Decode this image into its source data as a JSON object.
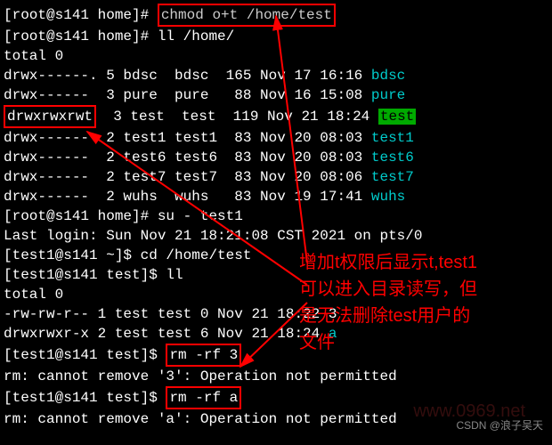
{
  "lines": {
    "l1_prompt": "[root@s141 home]# ",
    "l1_cmd": "chmod o+t /home/test",
    "l2": "[root@s141 home]# ll /home/",
    "l3": "total 0",
    "l4a": "drwx------. 5 bdsc  bdsc  165 Nov 17 16:16 ",
    "l4b": "bdsc",
    "l5a": "drwx------  3 pure  pure   88 Nov 16 15:08 ",
    "l5b": "pure",
    "l6perm": "drwxrwxrwt",
    "l6mid": "  3 test  test  119 Nov 21 18:24 ",
    "l6name": "test",
    "l7a": "drwx------  2 test1 test1  83 Nov 20 08:03 ",
    "l7b": "test1",
    "l8a": "drwx------  2 test6 test6  83 Nov 20 08:03 ",
    "l8b": "test6",
    "l9a": "drwx------  2 test7 test7  83 Nov 20 08:06 ",
    "l9b": "test7",
    "l10a": "drwx------  2 wuhs  wuhs   83 Nov 19 17:41 ",
    "l10b": "wuhs",
    "l11": "[root@s141 home]# su - test1",
    "l12": "Last login: Sun Nov 21 18:21:08 CST 2021 on pts/0",
    "l13": "[test1@s141 ~]$ cd /home/test",
    "l14": "[test1@s141 test]$ ll",
    "l15": "total 0",
    "l16": "-rw-rw-r-- 1 test test 0 Nov 21 18:22 3",
    "l17a": "drwxrwxr-x 2 test test 6 Nov 21 18:24 ",
    "l17b": "a",
    "l18_prompt": "[test1@s141 test]$ ",
    "l18_cmd": "rm -rf 3",
    "l19": "rm: cannot remove '3': Operation not permitted",
    "l20_prompt": "[test1@s141 test]$ ",
    "l20_cmd": "rm -rf a",
    "l21": "rm: cannot remove 'a': Operation not permitted"
  },
  "annotation": {
    "text1": "增加t权限后显示t,test1",
    "text2": "可以进入目录读写，但",
    "text3": "是无法删除test用户的",
    "text4": "文件"
  },
  "watermark": "CSDN @浪子吴天",
  "watermark2": "www.0969.net"
}
